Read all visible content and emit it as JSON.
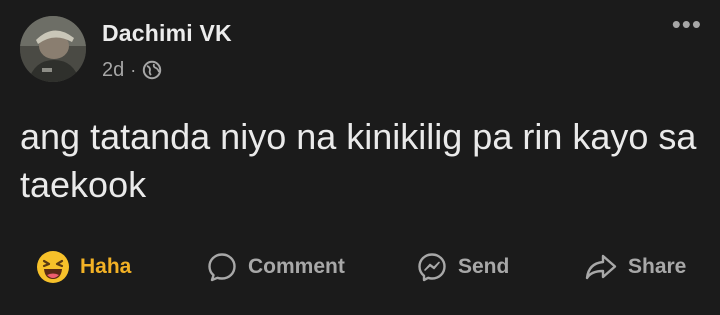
{
  "post": {
    "author": "Dachimi VK",
    "time": "2d",
    "separator": "·",
    "privacy_icon": "globe-icon",
    "more_label": "•••",
    "text": "ang tatanda niyo na kinikilig pa rin kayo sa taekook"
  },
  "actions": {
    "reaction_label": "Haha",
    "reaction_color": "#f2b125",
    "comment_label": "Comment",
    "send_label": "Send",
    "share_label": "Share"
  },
  "colors": {
    "background": "#1b1b1b",
    "text": "#eaeaea",
    "muted": "#a6a6a6"
  }
}
